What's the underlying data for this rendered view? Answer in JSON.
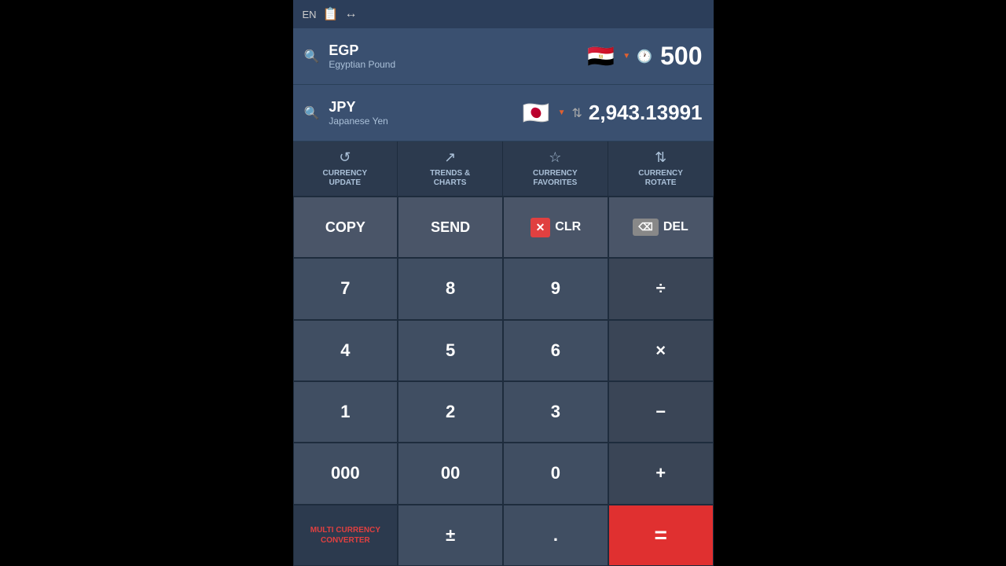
{
  "topbar": {
    "lang": "EN",
    "copy_icon": "📋",
    "rotate_icon": "↔"
  },
  "currency1": {
    "code": "EGP",
    "name": "Egyptian Pound",
    "flag": "🇪🇬",
    "value": "500",
    "has_history": true
  },
  "currency2": {
    "code": "JPY",
    "name": "Japanese Yen",
    "flag": "🇯🇵",
    "value": "2,943.13991",
    "has_swap": true
  },
  "actions": [
    {
      "id": "currency-update",
      "icon": "↺",
      "label": "CURRENCY\nUPDATE"
    },
    {
      "id": "trends-charts",
      "icon": "↗",
      "label": "TRENDS &\nCHARTS"
    },
    {
      "id": "currency-favorites",
      "icon": "☆",
      "label": "CURRENCY\nFAVORITES"
    },
    {
      "id": "currency-rotate",
      "icon": "⇅",
      "label": "CURRENCY\nROTATE"
    }
  ],
  "keypad": {
    "row1": [
      {
        "id": "copy",
        "label": "COPY",
        "type": "copy"
      },
      {
        "id": "send",
        "label": "SEND",
        "type": "send"
      },
      {
        "id": "clr",
        "label": "CLR",
        "type": "clr"
      },
      {
        "id": "del",
        "label": "DEL",
        "type": "del"
      }
    ],
    "row2": [
      {
        "id": "7",
        "label": "7"
      },
      {
        "id": "8",
        "label": "8"
      },
      {
        "id": "9",
        "label": "9"
      },
      {
        "id": "div",
        "label": "÷",
        "type": "operator"
      }
    ],
    "row3": [
      {
        "id": "4",
        "label": "4"
      },
      {
        "id": "5",
        "label": "5"
      },
      {
        "id": "6",
        "label": "6"
      },
      {
        "id": "mul",
        "label": "×",
        "type": "operator"
      }
    ],
    "row4": [
      {
        "id": "1",
        "label": "1"
      },
      {
        "id": "2",
        "label": "2"
      },
      {
        "id": "3",
        "label": "3"
      },
      {
        "id": "sub",
        "label": "−",
        "type": "operator"
      }
    ],
    "row5": [
      {
        "id": "000",
        "label": "000"
      },
      {
        "id": "00",
        "label": "00"
      },
      {
        "id": "0",
        "label": "0"
      },
      {
        "id": "add",
        "label": "+",
        "type": "operator"
      }
    ],
    "row6": [
      {
        "id": "multicurrency",
        "label": "MULTI CURRENCY\nCONVERTER",
        "type": "multicurrency"
      },
      {
        "id": "sign",
        "label": "±",
        "type": "sign"
      },
      {
        "id": "dot",
        "label": ".",
        "type": "dot"
      },
      {
        "id": "equals",
        "label": "=",
        "type": "equals"
      }
    ]
  }
}
